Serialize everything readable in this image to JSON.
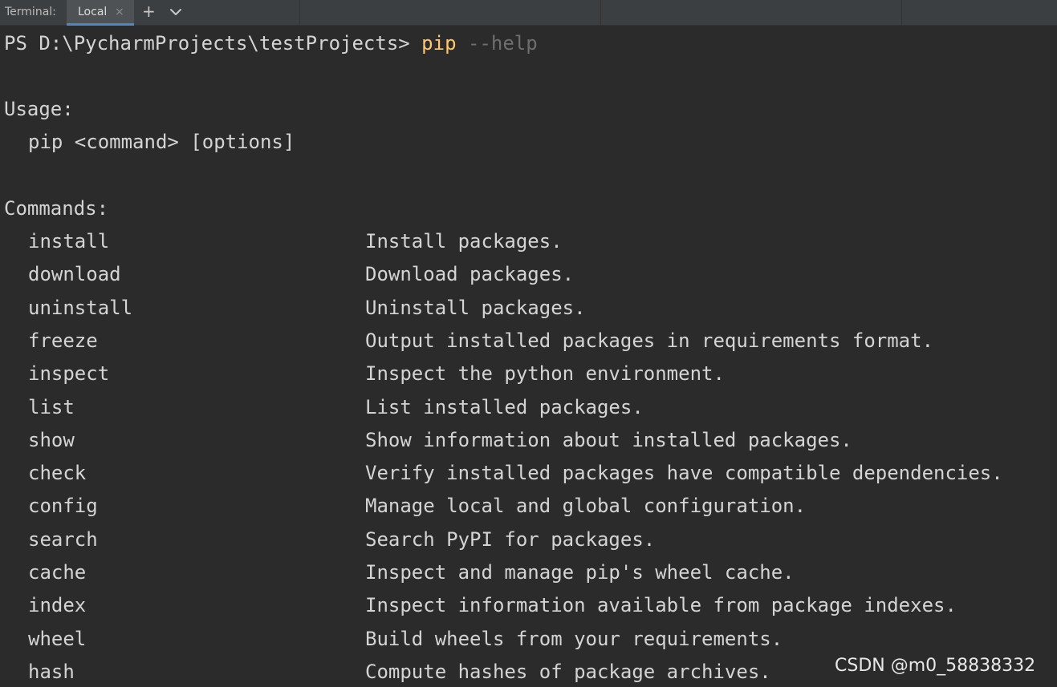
{
  "tabbar": {
    "title": "Terminal:",
    "tab_label": "Local",
    "close_glyph": "×",
    "new_tab_glyph": "+",
    "icons": [
      "close-icon",
      "plus-icon",
      "chevron-down-icon"
    ]
  },
  "terminal": {
    "prompt_path": "PS D:\\PycharmProjects\\testProjects> ",
    "prompt_command": "pip",
    "prompt_argument": " --help",
    "usage_header": "Usage:",
    "usage_line": "pip <command> [options]",
    "commands_header": "Commands:",
    "commands": [
      {
        "name": "install",
        "desc": "Install packages."
      },
      {
        "name": "download",
        "desc": "Download packages."
      },
      {
        "name": "uninstall",
        "desc": "Uninstall packages."
      },
      {
        "name": "freeze",
        "desc": "Output installed packages in requirements format."
      },
      {
        "name": "inspect",
        "desc": "Inspect the python environment."
      },
      {
        "name": "list",
        "desc": "List installed packages."
      },
      {
        "name": "show",
        "desc": "Show information about installed packages."
      },
      {
        "name": "check",
        "desc": "Verify installed packages have compatible dependencies."
      },
      {
        "name": "config",
        "desc": "Manage local and global configuration."
      },
      {
        "name": "search",
        "desc": "Search PyPI for packages."
      },
      {
        "name": "cache",
        "desc": "Inspect and manage pip's wheel cache."
      },
      {
        "name": "index",
        "desc": "Inspect information available from package indexes."
      },
      {
        "name": "wheel",
        "desc": "Build wheels from your requirements."
      },
      {
        "name": "hash",
        "desc": "Compute hashes of package archives."
      }
    ]
  },
  "watermark": "CSDN @m0_58838332",
  "colors": {
    "background": "#2b2b2b",
    "tabbar": "#3c3f41",
    "text": "#d4d4d4",
    "command_highlight": "#ffc66d",
    "argument_dim": "#6e6e6e",
    "tab_accent": "#4a88c7"
  }
}
